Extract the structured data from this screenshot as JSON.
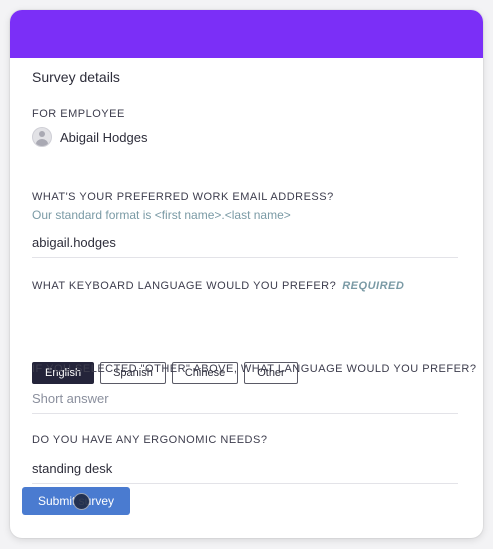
{
  "colors": {
    "header": "#7b2ff7",
    "selected_button": "#24243a",
    "submit_button": "#4a7bd0",
    "hint_text": "#7a9aa5"
  },
  "survey": {
    "title": "Survey details",
    "for_employee_label": "FOR EMPLOYEE",
    "employee_name": "Abigail Hodges",
    "avatar_icon": "user-avatar-icon"
  },
  "email_question": {
    "label": "WHAT'S YOUR PREFERRED WORK EMAIL ADDRESS?",
    "hint": "Our standard format is <first name>.<last name>",
    "value": "abigail.hodges"
  },
  "keyboard_question": {
    "label": "WHAT KEYBOARD LANGUAGE WOULD YOU PREFER?",
    "required": "REQUIRED",
    "options": [
      "English",
      "Spanish",
      "Chinese",
      "Other"
    ],
    "selected": "English"
  },
  "other_language_question": {
    "label": "IF YOU SELECTED \"OTHER\" ABOVE, WHAT LANGUAGE WOULD YOU PREFER?",
    "placeholder": "Short answer",
    "value": ""
  },
  "ergonomic_question": {
    "label": "DO YOU HAVE ANY ERGONOMIC NEEDS?",
    "value": "standing desk"
  },
  "submit_label": "Submit survey"
}
